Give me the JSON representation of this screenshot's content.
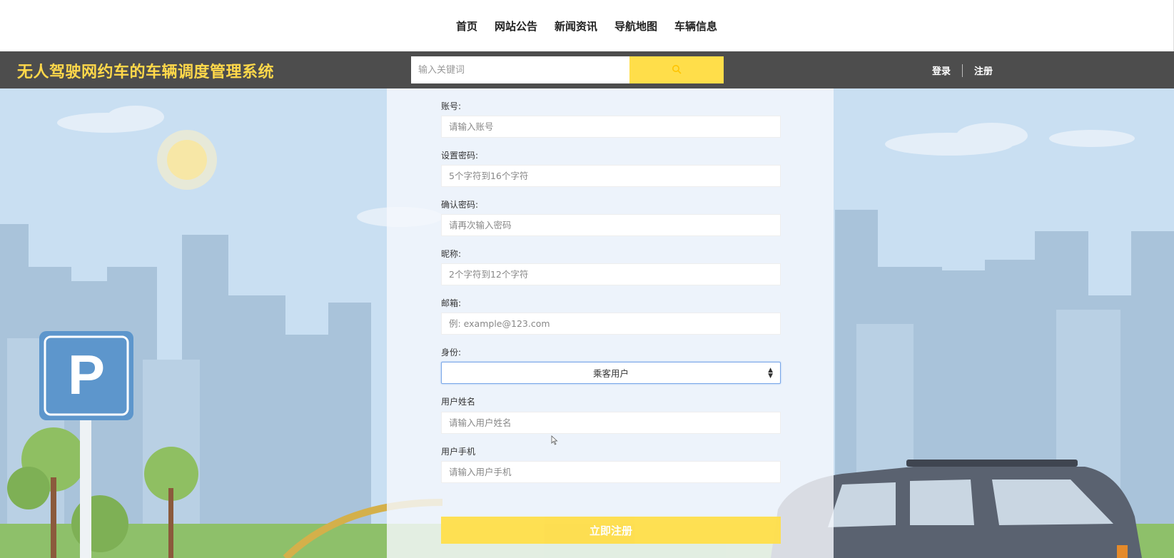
{
  "nav": {
    "items": [
      "首页",
      "网站公告",
      "新闻资讯",
      "导航地图",
      "车辆信息"
    ]
  },
  "header": {
    "site_title": "无人驾驶网约车的车辆调度管理系统",
    "search_placeholder": "输入关键词",
    "login_label": "登录",
    "register_label": "注册"
  },
  "form": {
    "account_label": "账号:",
    "account_placeholder": "请输入账号",
    "password_label": "设置密码:",
    "password_placeholder": "5个字符到16个字符",
    "confirm_label": "确认密码:",
    "confirm_placeholder": "请再次输入密码",
    "nickname_label": "昵称:",
    "nickname_placeholder": "2个字符到12个字符",
    "email_label": "邮箱:",
    "email_placeholder": "例: example@123.com",
    "role_label": "身份:",
    "role_value": "乘客用户",
    "realname_label": "用户姓名",
    "realname_placeholder": "请输入用户姓名",
    "phone_label": "用户手机",
    "phone_placeholder": "请输入用户手机",
    "submit_label": "立即注册"
  },
  "colors": {
    "accent": "#ffde4a",
    "header_bg": "#4d4d4d",
    "title_color": "#ffd84a",
    "sky": "#c9dff2"
  },
  "icons": {
    "search": "search-icon",
    "parking_sign": "P"
  }
}
